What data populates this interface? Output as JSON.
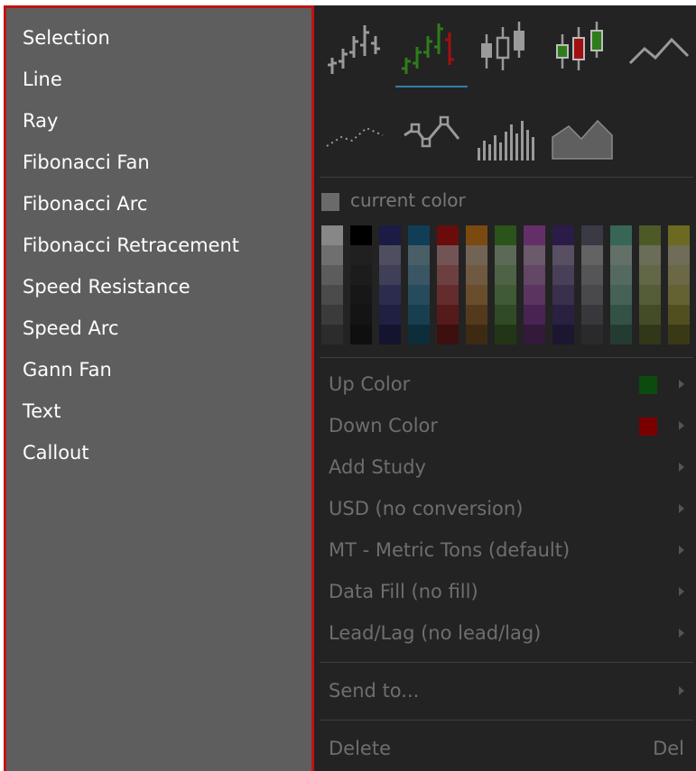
{
  "left_menu": {
    "items": [
      "Selection",
      "Line",
      "Ray",
      "Fibonacci Fan",
      "Fibonacci Arc",
      "Fibonacci Retracement",
      "Speed Resistance",
      "Speed Arc",
      "Gann Fan",
      "Text",
      "Callout"
    ]
  },
  "right_menu": {
    "chart_types": [
      {
        "name": "bar-chart-icon"
      },
      {
        "name": "colored-bar-chart-icon",
        "active": true
      },
      {
        "name": "candlestick-icon"
      },
      {
        "name": "colored-candlestick-icon"
      },
      {
        "name": "line-chart-icon"
      },
      {
        "name": "dot-chart-icon"
      },
      {
        "name": "line-with-markers-icon"
      },
      {
        "name": "histogram-icon"
      },
      {
        "name": "mountain-chart-icon"
      }
    ],
    "current_color_label": "current color",
    "current_color": "#6a6a6a",
    "palette": [
      [
        "#878787",
        "#6f6f6f",
        "#5c5c5c",
        "#4b4b4b",
        "#3b3b3b",
        "#2c2c2c"
      ],
      [
        "#000000",
        "#202020",
        "#1c1c1c",
        "#171717",
        "#141414",
        "#0f0f0f"
      ],
      [
        "#1b1b45",
        "#4e4e60",
        "#3f3f57",
        "#2c2c4e",
        "#202042",
        "#14142e"
      ],
      [
        "#0f3e56",
        "#4a5e68",
        "#3a5563",
        "#264b5d",
        "#173f50",
        "#0d2d3b"
      ],
      [
        "#6a0c0c",
        "#735454",
        "#6c4040",
        "#642c2c",
        "#551a1a",
        "#3d0f0f"
      ],
      [
        "#7a4a10",
        "#726454",
        "#6f5940",
        "#6a4d2d",
        "#543a1c",
        "#3d2a13"
      ],
      [
        "#2a541a",
        "#5d6957",
        "#4e6246",
        "#3f5a34",
        "#2f4a24",
        "#223617"
      ],
      [
        "#642f68",
        "#6a5a6b",
        "#644665",
        "#5b3560",
        "#472451",
        "#331a3a"
      ],
      [
        "#2a1c47",
        "#584f62",
        "#4a3f58",
        "#3a2f4d",
        "#2a2040",
        "#1d1630"
      ],
      [
        "#3a3a44",
        "#636363",
        "#555558",
        "#49494c",
        "#38383c",
        "#2a2a2d"
      ],
      [
        "#386656",
        "#627068",
        "#546a60",
        "#466257",
        "#345146",
        "#243b32"
      ],
      [
        "#4e5a26",
        "#6a6e58",
        "#626747",
        "#555d38",
        "#444c27",
        "#313719"
      ],
      [
        "#6c6a20",
        "#6f6d57",
        "#6a6845",
        "#646233",
        "#514f22",
        "#3a3915"
      ]
    ],
    "items": {
      "up_color": {
        "label": "Up Color",
        "chip": "#0d4a0d"
      },
      "down_color": {
        "label": "Down Color",
        "chip": "#7a0000"
      },
      "add_study": {
        "label": "Add Study"
      },
      "currency": {
        "label": "USD (no conversion)"
      },
      "units": {
        "label": "MT - Metric Tons (default)"
      },
      "data_fill": {
        "label": "Data Fill (no fill)"
      },
      "lead_lag": {
        "label": "Lead/Lag (no lead/lag)"
      },
      "send_to": {
        "label": "Send to..."
      },
      "delete": {
        "label": "Delete",
        "shortcut": "Del"
      }
    },
    "colors": {
      "menu_background": "#232323",
      "left_panel_background": "#5e5e5e",
      "left_panel_border": "#c01313",
      "active_underline": "#2f7fb1",
      "up_green": "#2e7d1a",
      "down_red": "#a01010"
    }
  }
}
